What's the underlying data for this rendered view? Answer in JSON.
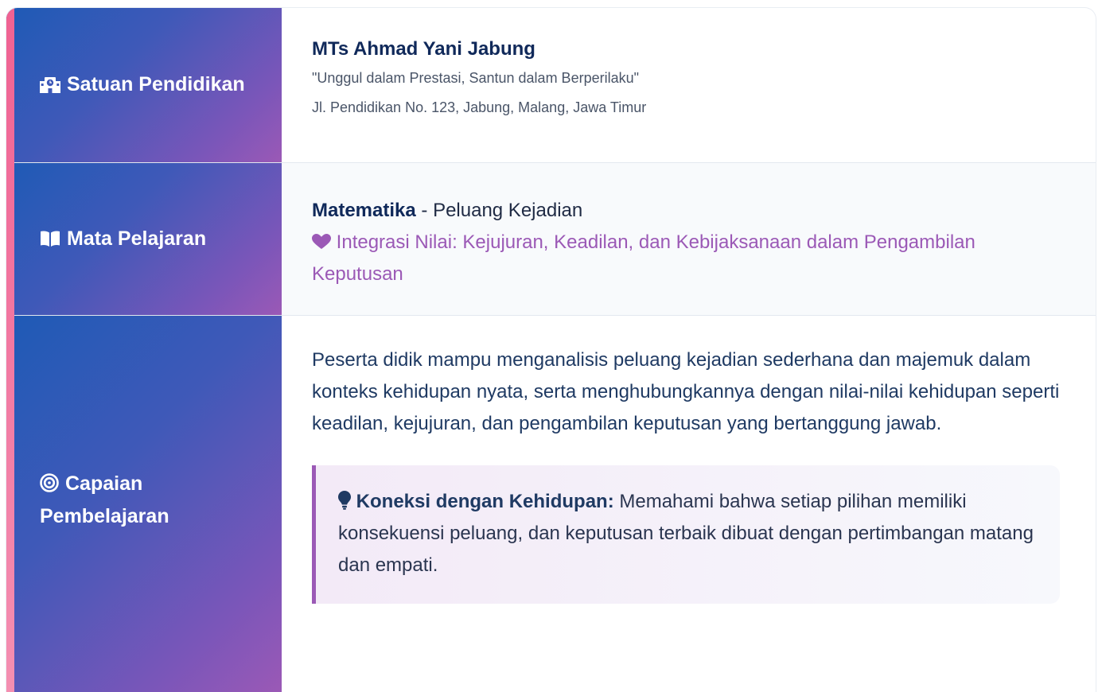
{
  "sections": {
    "school": {
      "label": "Satuan Pendidikan",
      "icon": "school-icon",
      "name": "MTs Ahmad Yani Jabung",
      "motto": "\"Unggul dalam Prestasi, Santun dalam Berperilaku\"",
      "address": "Jl. Pendidikan No. 123, Jabung, Malang, Jawa Timur"
    },
    "subject": {
      "label": "Mata Pelajaran",
      "icon": "book-open-icon",
      "name": "Matematika",
      "topic": " - Peluang Kejadian",
      "values_icon": "heart-icon",
      "values": "Integrasi Nilai: Kejujuran, Keadilan, dan Kebijaksanaan dalam Pengambilan Keputusan"
    },
    "outcome": {
      "label": "Capaian Pembelajaran",
      "icon": "target-icon",
      "text": "Peserta didik mampu menganalisis peluang kejadian sederhana dan majemuk dalam konteks kehidupan nyata, serta menghubungkannya dengan nilai-nilai kehidupan seperti keadilan, kejujuran, dan pengambilan keputusan yang bertanggung jawab.",
      "callout_icon": "lightbulb-icon",
      "callout_title": "Koneksi dengan Kehidupan:",
      "callout_text": " Memahami bahwa setiap pilihan memiliki konsekuensi peluang, dan keputusan terbaik dibuat dengan pertimbangan matang dan empati."
    }
  },
  "colors": {
    "accent_pink": "#f06292",
    "label_gradient_start": "#1e5ab6",
    "label_gradient_end": "#9b59b6",
    "purple": "#9b59b6",
    "navy": "#10295a"
  }
}
